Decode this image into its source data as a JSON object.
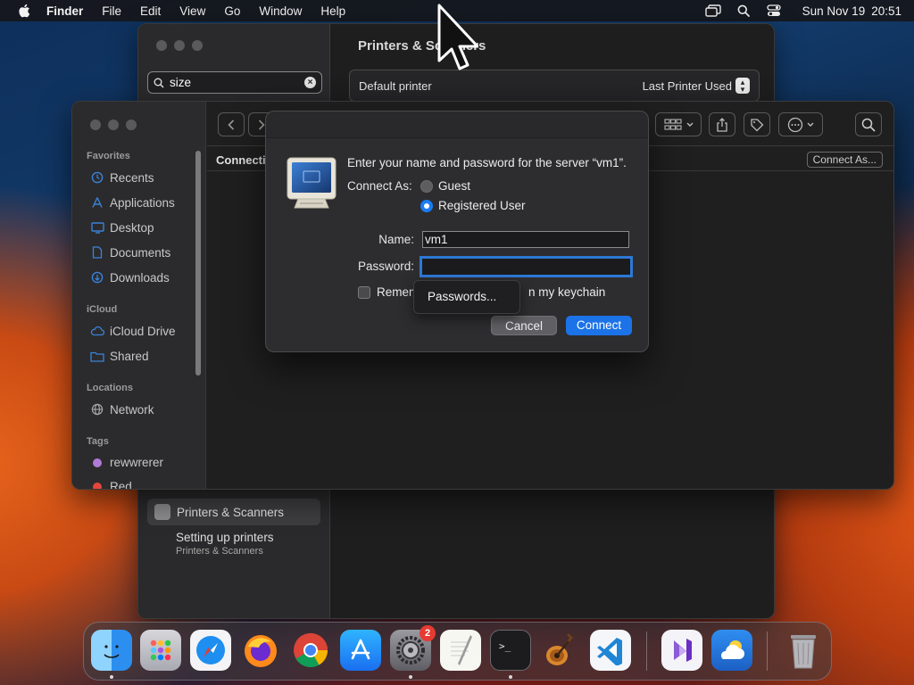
{
  "menubar": {
    "app_name": "Finder",
    "items": [
      "File",
      "Edit",
      "View",
      "Go",
      "Window",
      "Help"
    ],
    "date": "Sun Nov 19",
    "time": "20:51"
  },
  "settings_window": {
    "search_value": "size",
    "title": "Printers & Scanners",
    "default_printer_label": "Default printer",
    "default_printer_value": "Last Printer Used",
    "result_selected": "Printers & Scanners",
    "result_2_title": "Setting up printers",
    "result_2_sub": "Printers & Scanners"
  },
  "finder": {
    "sidebar": {
      "favorites_header": "Favorites",
      "favorites": [
        {
          "label": "Recents",
          "icon": "clock-icon"
        },
        {
          "label": "Applications",
          "icon": "applications-icon"
        },
        {
          "label": "Desktop",
          "icon": "desktop-icon"
        },
        {
          "label": "Documents",
          "icon": "document-icon"
        },
        {
          "label": "Downloads",
          "icon": "download-icon"
        }
      ],
      "icloud_header": "iCloud",
      "icloud": [
        {
          "label": "iCloud Drive",
          "icon": "cloud-icon"
        },
        {
          "label": "Shared",
          "icon": "shared-folder-icon"
        }
      ],
      "locations_header": "Locations",
      "locations": [
        {
          "label": "Network",
          "icon": "globe-icon"
        }
      ],
      "tags_header": "Tags",
      "tags": [
        {
          "label": "rewwrerer",
          "color": "#b07bd6"
        },
        {
          "label": "Red",
          "color": "#e5453c"
        }
      ]
    },
    "path_label": "Connecti",
    "connect_as_button": "Connect As..."
  },
  "dialog": {
    "message": "Enter your name and password for the server “vm1”.",
    "connect_as_label": "Connect As:",
    "guest_label": "Guest",
    "registered_label": "Registered User",
    "selected": "Registered User",
    "name_label": "Name:",
    "name_value": "vm1",
    "password_label": "Password:",
    "password_value": "",
    "remember_left": "Remem",
    "remember_right": "n my keychain",
    "remember_checked": false,
    "cancel_label": "Cancel",
    "connect_label": "Connect",
    "accent": "#1c73e8"
  },
  "popover": {
    "label": "Passwords..."
  },
  "dock": {
    "apps": [
      "Finder",
      "Launchpad",
      "Safari",
      "Firefox",
      "Chrome",
      "App Store",
      "System Settings",
      "TextEdit",
      "Terminal",
      "GarageBand",
      "Visual Studio Code",
      "Visual Studio",
      "Weather",
      "Trash"
    ],
    "settings_badge": "2"
  }
}
